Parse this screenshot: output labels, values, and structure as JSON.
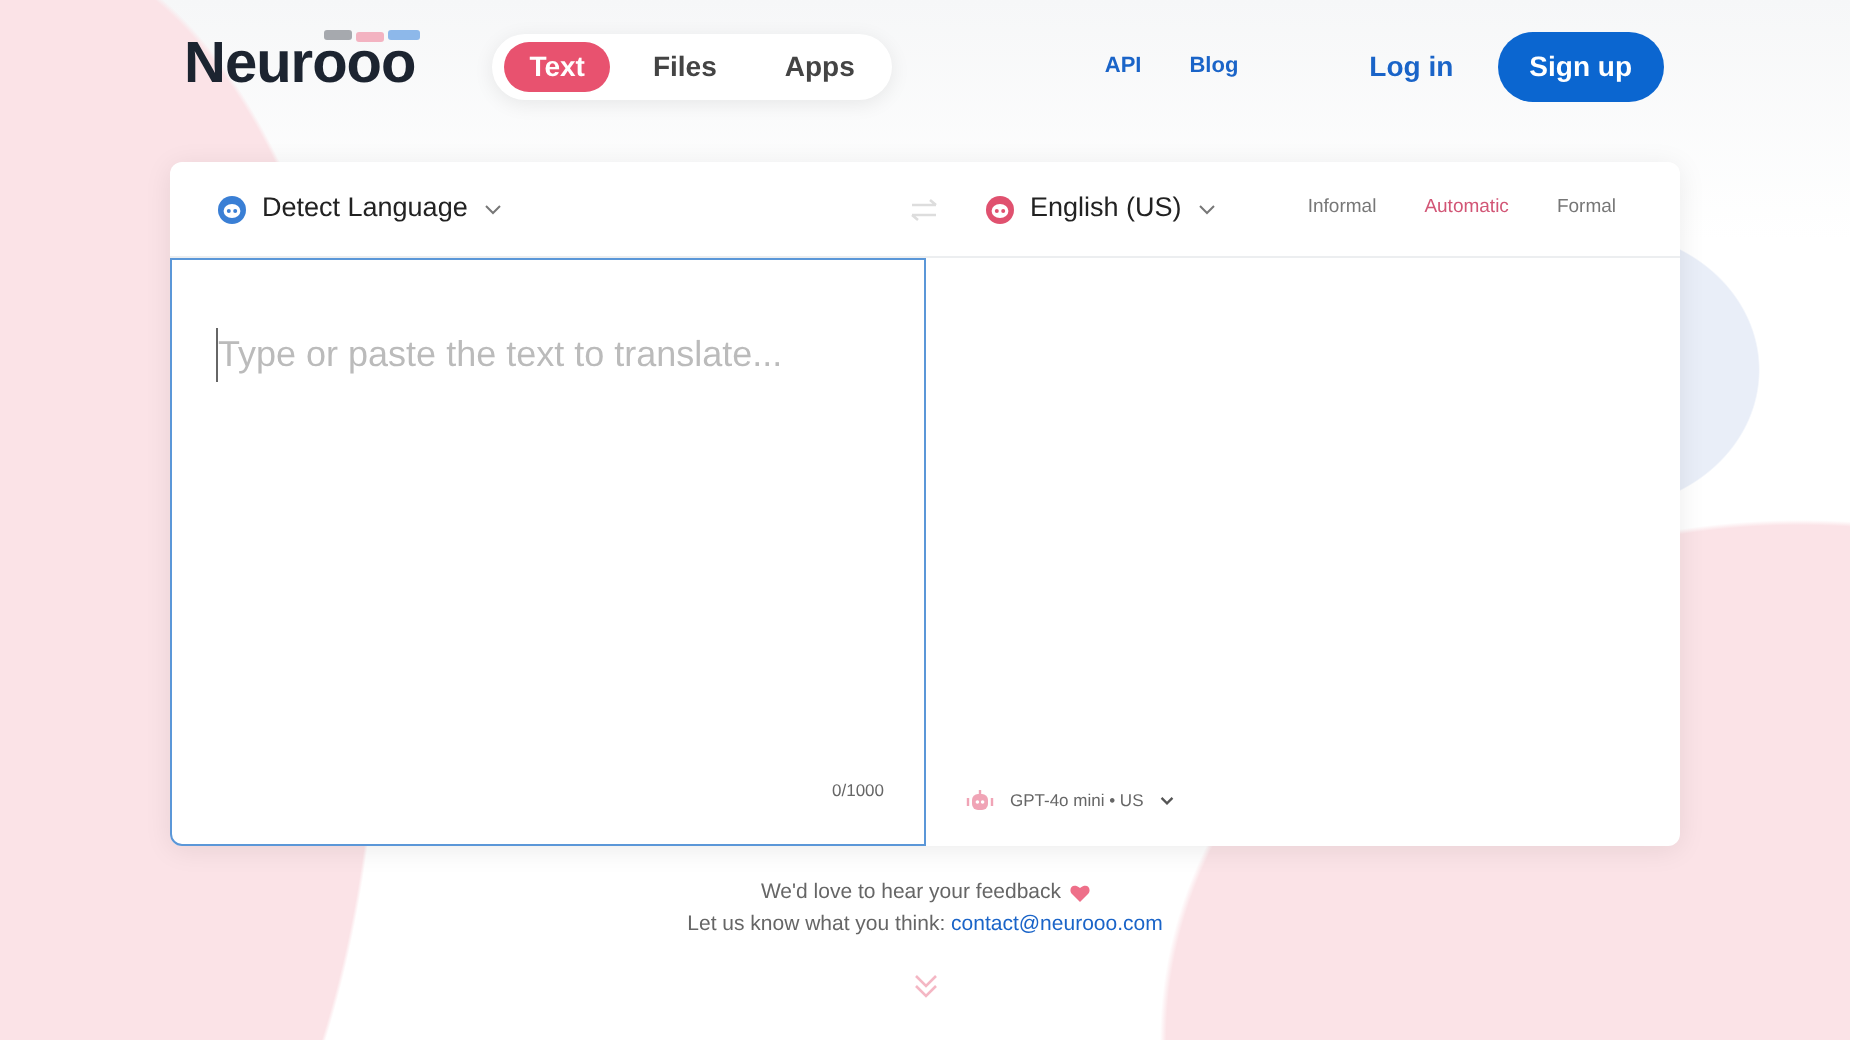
{
  "logo": "Neurooo",
  "tabs": [
    {
      "label": "Text",
      "selected": true
    },
    {
      "label": "Files",
      "selected": false
    },
    {
      "label": "Apps",
      "selected": false
    }
  ],
  "links": [
    "API",
    "Blog"
  ],
  "login": "Log in",
  "signup": "Sign up",
  "source_language": "Detect Language",
  "target_language": "English (US)",
  "tones": [
    {
      "label": "Informal",
      "selected": false
    },
    {
      "label": "Automatic",
      "selected": true
    },
    {
      "label": "Formal",
      "selected": false
    }
  ],
  "input": {
    "placeholder": "Type or paste the text to translate...",
    "counter": "0/1000"
  },
  "model": "GPT-4o mini • US",
  "feedback": "We'd love to hear your feedback",
  "contact_prompt": "Let us know what you think:",
  "contact_email": "contact@neurooo.com"
}
